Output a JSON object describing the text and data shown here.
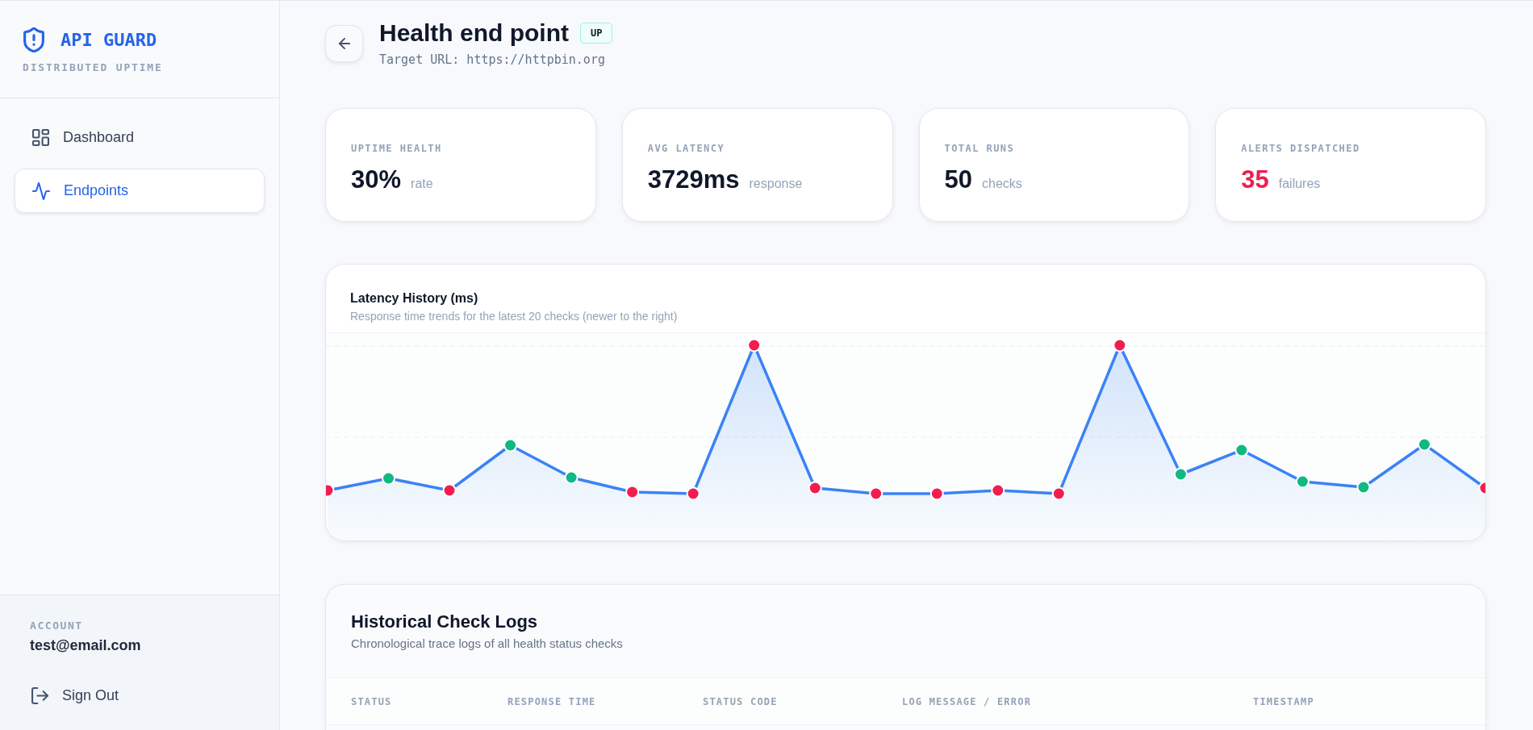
{
  "sidebar": {
    "brand": {
      "title": "API GUARD",
      "subtitle": "DISTRIBUTED UPTIME"
    },
    "nav": [
      {
        "label": "Dashboard",
        "selected": false
      },
      {
        "label": "Endpoints",
        "selected": true
      }
    ],
    "account": {
      "label": "ACCOUNT",
      "email": "test@email.com"
    },
    "sign_out": "Sign Out"
  },
  "header": {
    "title": "Health end point",
    "status_badge": "UP",
    "target_url": "Target URL: https://httpbin.org"
  },
  "stats": [
    {
      "label": "UPTIME HEALTH",
      "value": "30%",
      "unit": "rate",
      "kind": "plain"
    },
    {
      "label": "AVG LATENCY",
      "value": "3729ms",
      "unit": "response",
      "kind": "plain"
    },
    {
      "label": "TOTAL RUNS",
      "value": "50",
      "unit": "checks",
      "kind": "plain"
    },
    {
      "label": "ALERTS DISPATCHED",
      "value": "35",
      "unit": "failures",
      "kind": "alert"
    }
  ],
  "latency_chart": {
    "title": "Latency History (ms)",
    "subtitle": "Response time trends for the latest 20 checks (newer to the right)",
    "points": [
      {
        "color": "#f11d4f"
      },
      {
        "color": "#10b981"
      },
      {
        "color": "#f11d4f"
      },
      {
        "color": "#10b981"
      },
      {
        "color": "#10b981"
      },
      {
        "color": "#f11d4f"
      },
      {
        "color": "#f11d4f"
      },
      {
        "color": "#f11d4f"
      },
      {
        "color": "#f11d4f"
      },
      {
        "color": "#f11d4f"
      },
      {
        "color": "#f11d4f"
      },
      {
        "color": "#f11d4f"
      },
      {
        "color": "#f11d4f"
      },
      {
        "color": "#f11d4f"
      },
      {
        "color": "#10b981"
      },
      {
        "color": "#10b981"
      },
      {
        "color": "#10b981"
      },
      {
        "color": "#10b981"
      },
      {
        "color": "#10b981"
      },
      {
        "color": "#f11d4f"
      }
    ]
  },
  "logs": {
    "title": "Historical Check Logs",
    "subtitle": "Chronological trace logs of all health status checks",
    "columns": [
      "STATUS",
      "RESPONSE TIME",
      "STATUS CODE",
      "LOG MESSAGE / ERROR",
      "TIMESTAMP"
    ]
  }
}
